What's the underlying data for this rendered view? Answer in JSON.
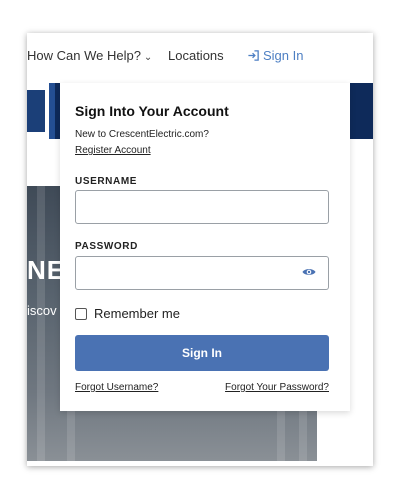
{
  "nav": {
    "help_label": "How Can We Help?",
    "help_chevron": "⌄",
    "locations_label": "Locations",
    "signin_label": "Sign In",
    "signin_color": "#4d7fc3"
  },
  "background": {
    "hero_heading_fragment": "NE",
    "hero_subtext_fragment": "iscov",
    "banner_color": "#0e2a5a"
  },
  "popup": {
    "title": "Sign Into Your Account",
    "new_to": "New to CrescentElectric.com?",
    "register_link": "Register Account",
    "username_label": "USERNAME",
    "username_value": "",
    "password_label": "PASSWORD",
    "password_value": "",
    "show_password_icon": "eye-icon",
    "remember_label": "Remember me",
    "remember_checked": false,
    "signin_button": "Sign In",
    "signin_button_color": "#4a72b3",
    "forgot_username": "Forgot Username?",
    "forgot_password": "Forgot Your Password?"
  }
}
